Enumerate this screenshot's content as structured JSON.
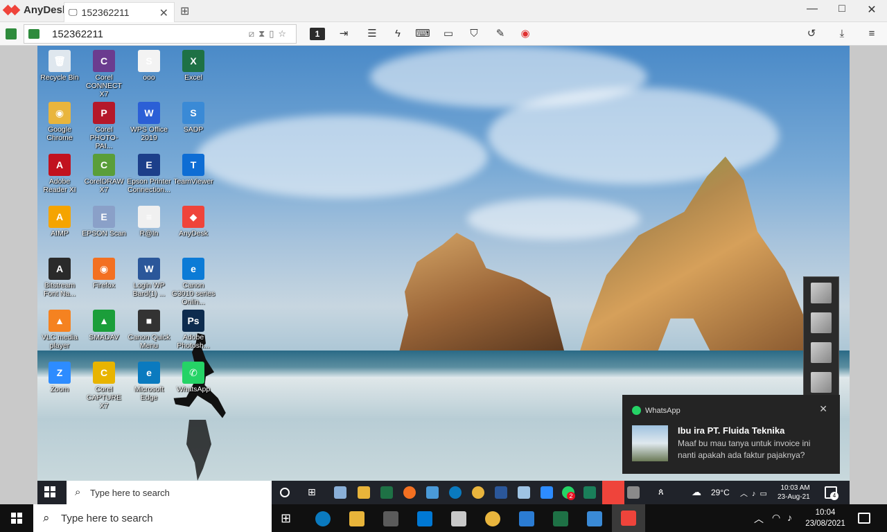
{
  "anydesk": {
    "brand": "AnyDesk",
    "tab_label": "152362211",
    "tab_close": "✕",
    "new_tab": "⊞",
    "window": {
      "minimize": "—",
      "maximize": "□",
      "close": "✕"
    },
    "address_value": "152362211",
    "monitor_number": "1",
    "toolbar_icons": [
      "file-transfer-icon",
      "chat-icon",
      "actions-icon",
      "keyboard-icon",
      "display-icon",
      "permissions-icon",
      "whiteboard-icon",
      "record-icon",
      "history-icon",
      "install-icon",
      "menu-icon"
    ],
    "accent_color": "#ef443b"
  },
  "desktop": {
    "icons": [
      {
        "label": "Recycle Bin",
        "color": "#dfe7ee",
        "glyph": "🗑"
      },
      {
        "label": "Corel CONNECT X7",
        "color": "#6b3c8f",
        "glyph": "C"
      },
      {
        "label": "ooo",
        "color": "#f3f3f3",
        "glyph": "S"
      },
      {
        "label": "Excel",
        "color": "#1e7145",
        "glyph": "X"
      },
      {
        "label": "Google Chrome",
        "color": "#e9b53d",
        "glyph": "◉"
      },
      {
        "label": "Corel PHOTO-PAI...",
        "color": "#b5182a",
        "glyph": "P"
      },
      {
        "label": "WPS Office 2019",
        "color": "#2b5fd6",
        "glyph": "W"
      },
      {
        "label": "SADP",
        "color": "#3a8ad6",
        "glyph": "S"
      },
      {
        "label": "Adobe Reader XI",
        "color": "#c1121f",
        "glyph": "A"
      },
      {
        "label": "CorelDRAW X7",
        "color": "#5a9e3a",
        "glyph": "C"
      },
      {
        "label": "Epson Printer Connection...",
        "color": "#1c3f8a",
        "glyph": "E"
      },
      {
        "label": "TeamViewer",
        "color": "#0e6dd4",
        "glyph": "T"
      },
      {
        "label": "AIMP",
        "color": "#f5a400",
        "glyph": "A"
      },
      {
        "label": "EPSON Scan",
        "color": "#8aa0c8",
        "glyph": "E"
      },
      {
        "label": "R@In",
        "color": "#f0f0f0",
        "glyph": "≡"
      },
      {
        "label": "AnyDesk",
        "color": "#ef443b",
        "glyph": "◆"
      },
      {
        "label": "Bitstream Font Na...",
        "color": "#2a2a2a",
        "glyph": "A"
      },
      {
        "label": "Firefox",
        "color": "#f37021",
        "glyph": "◉"
      },
      {
        "label": "Login WP Bard(1) ...",
        "color": "#2b579a",
        "glyph": "W"
      },
      {
        "label": "Canon G3010 series Onlin...",
        "color": "#0c7bd6",
        "glyph": "e"
      },
      {
        "label": "VLC media player",
        "color": "#f58220",
        "glyph": "▲"
      },
      {
        "label": "SMADAV",
        "color": "#1b9e3a",
        "glyph": "▲"
      },
      {
        "label": "Canon Quick Menu",
        "color": "#333333",
        "glyph": "■"
      },
      {
        "label": "Adobe Photosh...",
        "color": "#0d2b4e",
        "glyph": "Ps"
      },
      {
        "label": "Zoom",
        "color": "#2d8cff",
        "glyph": "Z"
      },
      {
        "label": "Corel CAPTURE X7",
        "color": "#e8b400",
        "glyph": "C"
      },
      {
        "label": "Microsoft Edge",
        "color": "#0a7abf",
        "glyph": "e"
      },
      {
        "label": "WhatsApp",
        "color": "#25d366",
        "glyph": "✆"
      }
    ]
  },
  "toast": {
    "app": "WhatsApp",
    "close": "✕",
    "title": "Ibu ira PT. Fluida Teknika",
    "message": "Maaf bu mau tanya untuk invoice ini nanti apakah ada faktur pajaknya?"
  },
  "remote_taskbar": {
    "search_placeholder": "Type here to search",
    "weather": "29°C",
    "time": "10:03 AM",
    "date": "23-Aug-21",
    "notif_count": "4",
    "whatsapp_badge": "2"
  },
  "local_taskbar": {
    "search_placeholder": "Type here to search",
    "time": "10:04",
    "date": "23/08/2021"
  }
}
